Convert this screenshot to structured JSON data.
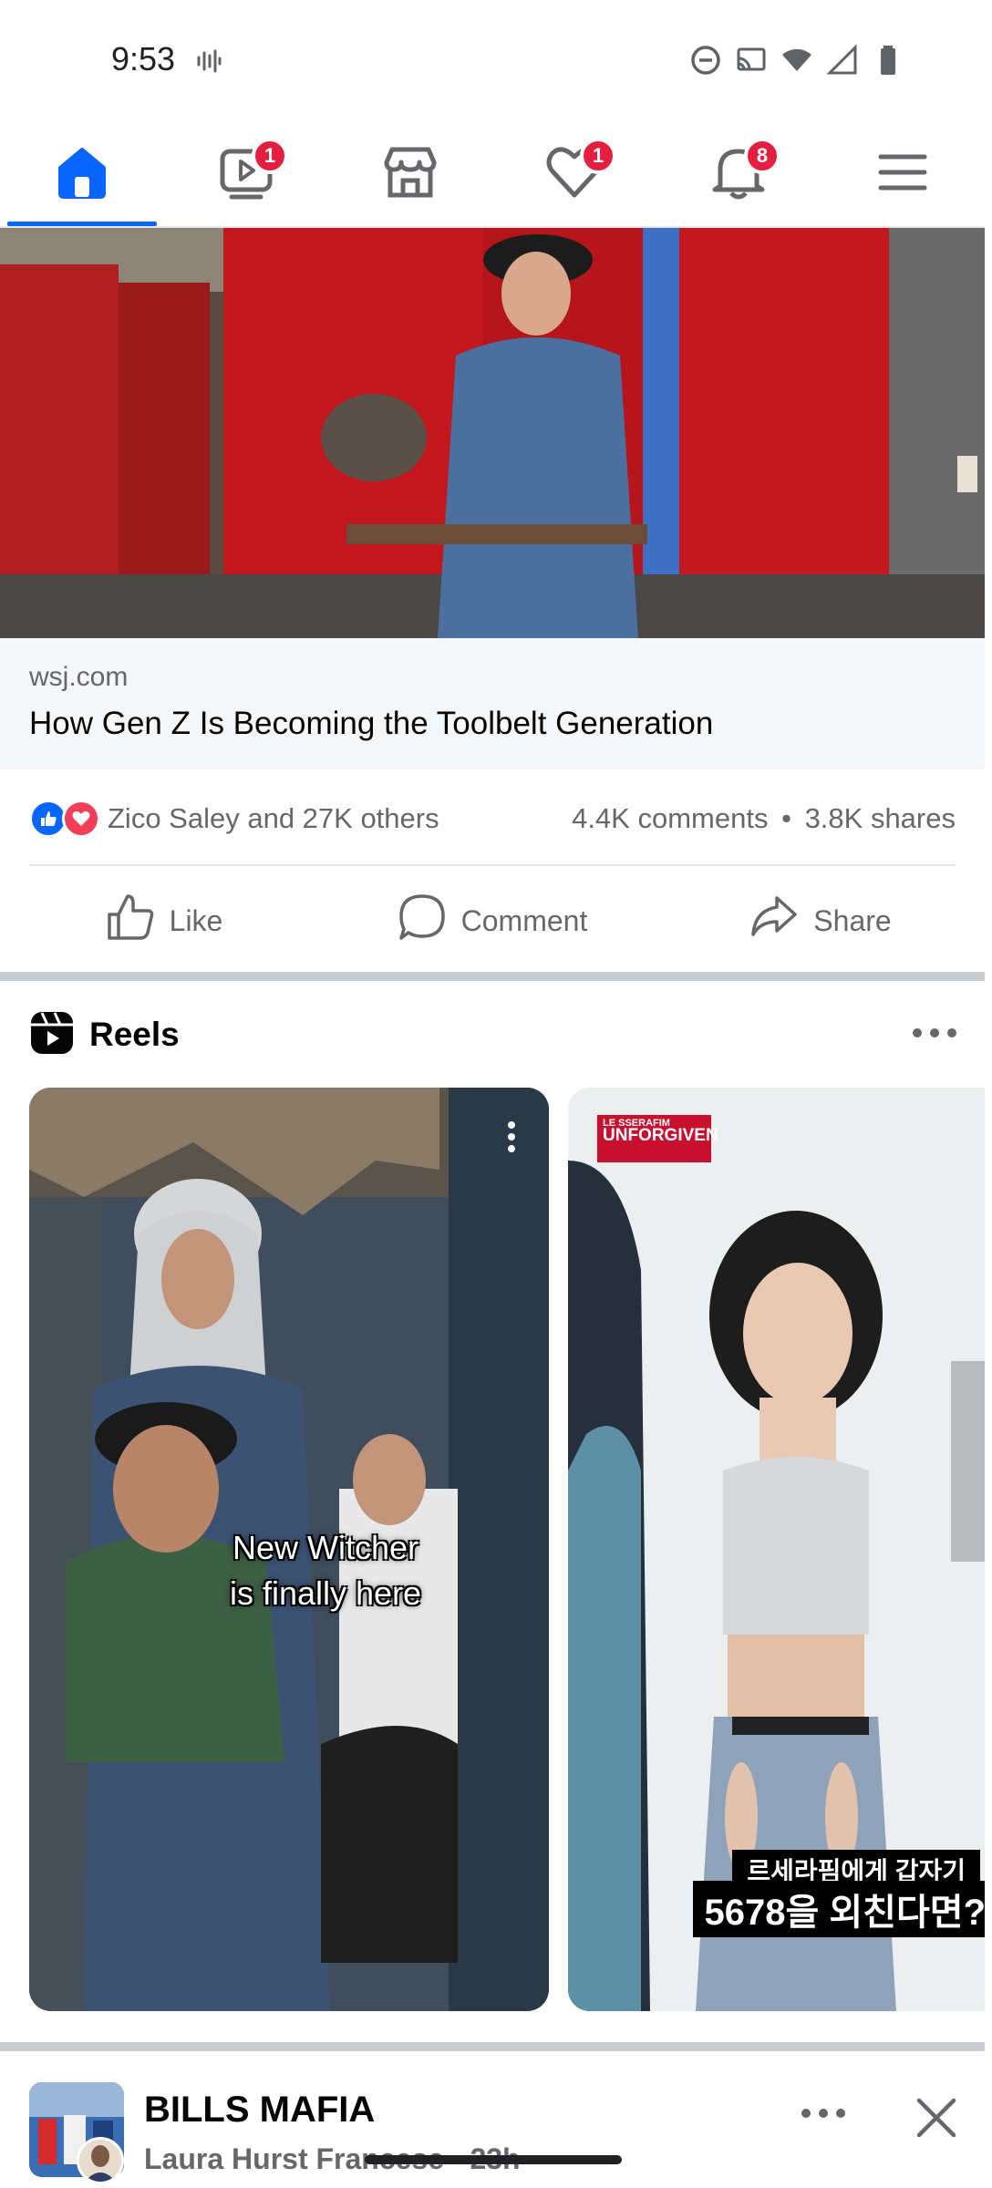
{
  "status_bar": {
    "time": "9:53"
  },
  "nav": {
    "tabs": [
      {
        "name": "home",
        "badge": ""
      },
      {
        "name": "video",
        "badge": "1"
      },
      {
        "name": "marketplace",
        "badge": ""
      },
      {
        "name": "dating",
        "badge": "1"
      },
      {
        "name": "notifications",
        "badge": "8"
      },
      {
        "name": "menu",
        "badge": ""
      }
    ]
  },
  "post": {
    "link_domain": "wsj.com",
    "link_title": "How Gen Z Is Becoming the Toolbelt Generation",
    "reactions_text": "Zico Saley and 27K others",
    "comments": "4.4K comments",
    "dot": "•",
    "shares": "3.8K shares",
    "actions": {
      "like": "Like",
      "comment": "Comment",
      "share": "Share"
    }
  },
  "reels": {
    "title": "Reels",
    "items": [
      {
        "caption_line1": "New Witcher",
        "caption_line2": "is finally here"
      },
      {
        "logo_small": "LE SSERAFIM",
        "logo_big": "UNFORGIVEN",
        "subtitle1": "르세라핌에게 갑자기",
        "subtitle2": "5678을 외친다면?"
      }
    ]
  },
  "next_post": {
    "title": "BILLS MAFIA",
    "subtitle": "Laura Hurst Francese · 23h ·"
  },
  "colors": {
    "accent": "#0866ff",
    "badge": "#e41e3f",
    "secondary_text": "#65676b"
  }
}
